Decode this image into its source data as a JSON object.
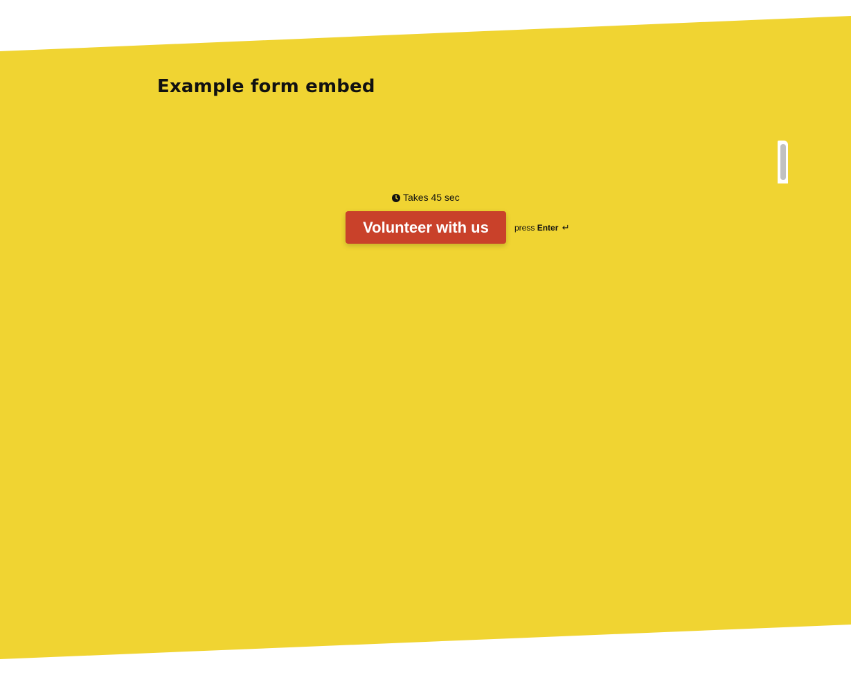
{
  "page": {
    "heading": "Example form embed"
  },
  "form_embed": {
    "duration_text": "Takes 45 sec",
    "cta_label": "Volunteer with us",
    "hint_prefix": "press",
    "hint_key": "Enter",
    "hint_icon": "↵"
  },
  "icons": {
    "clock": "clock-icon",
    "enter": "enter-key-icon"
  },
  "colors": {
    "background_band": "#f0d432",
    "button": "#c9412a",
    "button_text": "#ffffff",
    "text": "#111111",
    "scrollbar_thumb": "#c1c1c1"
  }
}
